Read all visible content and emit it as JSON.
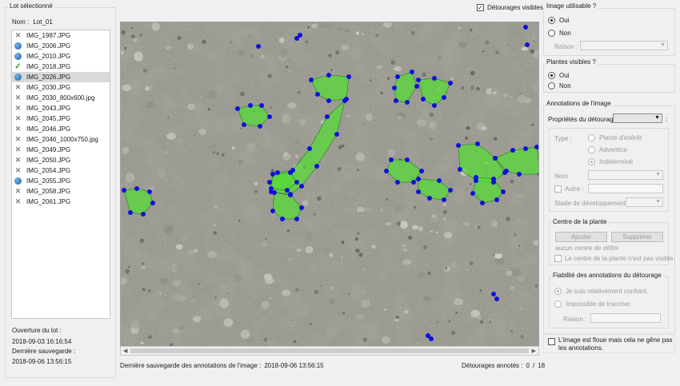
{
  "left": {
    "group_title": "Lot sélectionné",
    "name_label": "Nom :",
    "name_value": "Lot_01",
    "files": [
      {
        "name": "IMG_1987.JPG",
        "status": "x-icon"
      },
      {
        "name": "IMG_2006.JPG",
        "status": "blue-circle-icon"
      },
      {
        "name": "IMG_2010.JPG",
        "status": "blue-circle-icon"
      },
      {
        "name": "IMG_2018.JPG",
        "status": "check-icon"
      },
      {
        "name": "IMG_2026.JPG",
        "status": "blue-circle-icon",
        "selected": true
      },
      {
        "name": "IMG_2030.JPG",
        "status": "x-icon"
      },
      {
        "name": "IMG_2030_800x600.jpg",
        "status": "x-icon"
      },
      {
        "name": "IMG_2043.JPG",
        "status": "x-icon"
      },
      {
        "name": "IMG_2045.JPG",
        "status": "x-icon"
      },
      {
        "name": "IMG_2046.JPG",
        "status": "x-icon"
      },
      {
        "name": "IMG_2046_1000x750.jpg",
        "status": "x-icon"
      },
      {
        "name": "IMG_2049.JPG",
        "status": "x-icon"
      },
      {
        "name": "IMG_2050.JPG",
        "status": "x-icon"
      },
      {
        "name": "IMG_2054.JPG",
        "status": "x-icon"
      },
      {
        "name": "IMG_2055.JPG",
        "status": "blue-circle-icon"
      },
      {
        "name": "IMG_2058.JPG",
        "status": "x-icon"
      },
      {
        "name": "IMG_2061.JPG",
        "status": "x-icon"
      }
    ],
    "open_label": "Ouverture du lot :",
    "open_value": "2018-09-03 16:16:54",
    "save_label": "Dernière sauvegarde :",
    "save_value": "2018-09-06 13:56:15"
  },
  "center": {
    "show_outlines_label": "Détourages visibles",
    "show_outlines_checked": true,
    "last_save_label": "Dernière sauvegarde des annotations de l'image :",
    "last_save_value": "2018-09-06 13:56:15",
    "annotated_label": "Détourages annotés :",
    "annotated_count": "0",
    "annotated_sep": "/",
    "annotated_total": "18"
  },
  "right": {
    "usable": {
      "title": "Image utilisable ?",
      "yes": "Oui",
      "no": "Non",
      "reason_label": "Raison :"
    },
    "plants": {
      "title": "Plantes visibles ?",
      "yes": "Oui",
      "no": "Non"
    },
    "annotations": {
      "title": "Annotations de l'image",
      "props_label": "Propriétés du détourage",
      "props_colon": ":",
      "type_label": "Type :",
      "type_options": [
        "Plante d'intérêt",
        "Adventice",
        "Indéterminé"
      ],
      "name_label": "Nom :",
      "other_label": "Autre :",
      "stage_label": "Stade de développement :"
    },
    "center_plant": {
      "title": "Centre de la plante",
      "add_btn": "Ajouter",
      "delete_btn": "Supprimer",
      "none_text": "aucun centre de défini",
      "not_visible": "Le centre de la plante n'est pas visible."
    },
    "reliability": {
      "title": "Fiabilité des annotations du détourage",
      "confident": "Je suis relativement confiant.",
      "impossible": "Impossible de trancher.",
      "reason_label": "Raison :"
    },
    "blurry_label": "L'image est floue mais cela ne gêne pas les annotations."
  },
  "colors": {
    "outline_fill": "#55dd33",
    "vertex": "#1010dd",
    "soil": "#8f8f86"
  }
}
